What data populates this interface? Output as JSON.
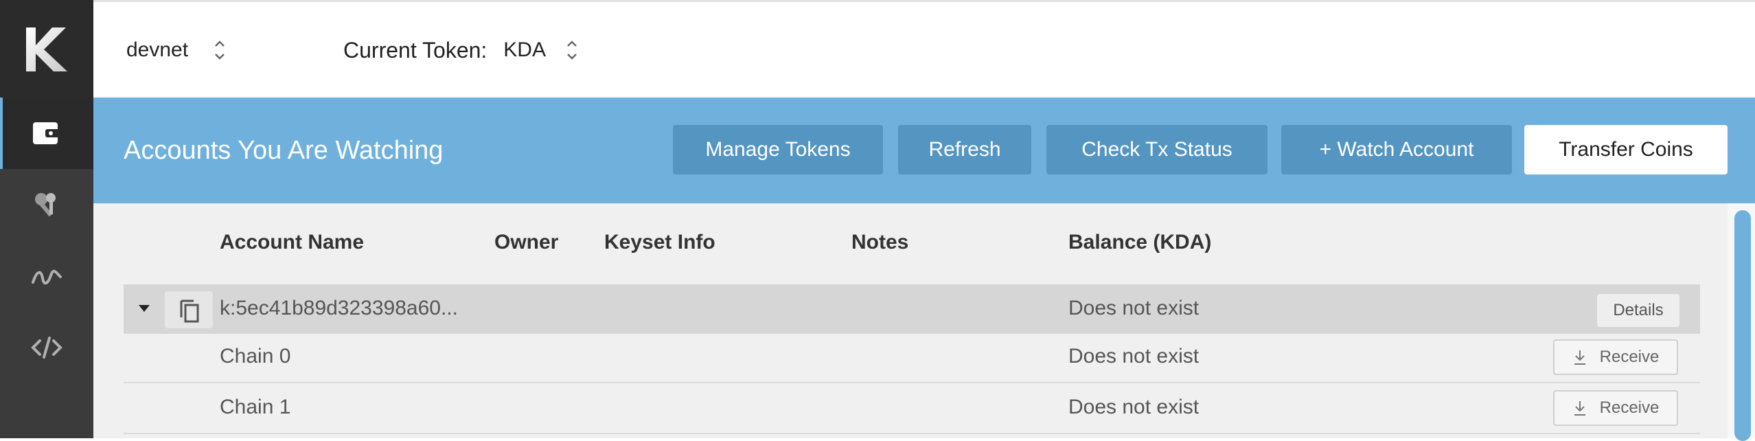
{
  "sidebar": {
    "logo_letter": "K",
    "items": [
      {
        "icon": "wallet-icon",
        "active": true
      },
      {
        "icon": "keys-icon",
        "active": false
      },
      {
        "icon": "signature-icon",
        "active": false
      },
      {
        "icon": "code-icon",
        "active": false
      }
    ]
  },
  "topbar": {
    "network": "devnet",
    "token_label": "Current Token:",
    "token_value": "KDA"
  },
  "header": {
    "title": "Accounts You Are Watching",
    "buttons": {
      "manage_tokens": "Manage Tokens",
      "refresh": "Refresh",
      "check_tx": "Check Tx Status",
      "watch_account": "+ Watch Account",
      "transfer_coins": "Transfer Coins"
    }
  },
  "table": {
    "columns": {
      "account_name": "Account Name",
      "owner": "Owner",
      "keyset_info": "Keyset Info",
      "notes": "Notes",
      "balance": "Balance (KDA)"
    },
    "account": {
      "name": "k:5ec41b89d323398a60...",
      "balance": "Does not exist",
      "details_label": "Details"
    },
    "chains": [
      {
        "name": "Chain 0",
        "balance": "Does not exist",
        "action": "Receive"
      },
      {
        "name": "Chain 1",
        "balance": "Does not exist",
        "action": "Receive"
      }
    ]
  },
  "colors": {
    "accent": "#6fb1dc",
    "button": "#5595c1",
    "sidebar": "#3b3b3b"
  }
}
